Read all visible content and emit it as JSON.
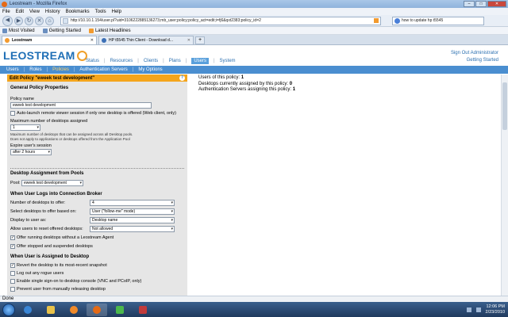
{
  "browser": {
    "window_title": "Leostream - Mozilla Firefox",
    "menu": [
      "File",
      "Edit",
      "View",
      "History",
      "Bookmarks",
      "Tools",
      "Help"
    ],
    "url": "http://10.10.1.154/user.pl?uid=3106222885136273;mb_user;policy;policy_act=edit;i=fj6&qxt2383;policy_id=2",
    "search": "how to update hp t5545",
    "bookmarks": [
      "Most Visited",
      "Getting Started",
      "Latest Headlines"
    ],
    "tabs": [
      {
        "label": "Leostream",
        "active": true
      },
      {
        "label": "HP t5545 Thin Client - Download d...",
        "active": false
      }
    ],
    "status": "Done"
  },
  "app": {
    "logo": "LEOSTREAM",
    "main_nav": [
      "Status",
      "Resources",
      "Clients",
      "Plans",
      "Users",
      "System"
    ],
    "main_nav_active": "Users",
    "sign_out": "Sign Out Administrator",
    "getting_started": "Getting Started",
    "sub_nav": [
      "Users",
      "Roles",
      "Policies",
      "Authentication Servers",
      "My Options"
    ],
    "sub_nav_active": "Policies"
  },
  "panel": {
    "heading": "Edit Policy \"eweek test development\"",
    "general_title": "General Policy Properties",
    "policy_name_label": "Policy name",
    "policy_name_value": "eweek test development",
    "auto_launch_label": "Auto-launch remote viewer session if only one desktop is offered (Web client, only)",
    "max_desktops_label": "Maximum number of desktops assigned",
    "max_desktops_value": "1",
    "max_help_1": "Maximum number of desktops that can be assigned across all Desktop pools.",
    "max_help_2": "Does not apply to applications or desktops offered from the Application Pool",
    "expire_label": "Expire user's session",
    "expire_value": "after 2 hours",
    "pools_title": "Desktop Assignment from Pools",
    "pool_label": "Pool:",
    "pool_value": "eweek test development",
    "login_title": "When User Logs into Connection Broker",
    "num_offer_label": "Number of desktops to offer:",
    "num_offer_value": "4",
    "select_offer_label": "Select desktops to offer based on:",
    "select_offer_value": "User  (\"follow-me\" mode)",
    "display_label": "Display to user as:",
    "display_value": "Desktop name",
    "allow_reset_label": "Allow users to reset offered desktops:",
    "allow_reset_value": "Not allowed",
    "offer_running_label": "Offer running desktops without a Leostream Agent",
    "offer_stopped_label": "Offer stopped and suspended desktops",
    "assigned_title": "When User is Assigned to Desktop",
    "revert_label": "Revert the desktop to its most-recent snapshot",
    "logout_label": "Log out any rogue users",
    "sso_label": "Enable single sign-on to desktop console (VNC and PCoIP, only)",
    "prevent_label": "Prevent user from manually releasing desktop"
  },
  "info": {
    "users_label": "Users of this policy:",
    "users_value": "1",
    "desktops_label": "Desktops currently assigned by this policy:",
    "desktops_value": "0",
    "auth_label": "Authentication Servers assigning this policy:",
    "auth_value": "1"
  },
  "taskbar": {
    "time": "12:06 PM",
    "date": "2/23/2010"
  }
}
